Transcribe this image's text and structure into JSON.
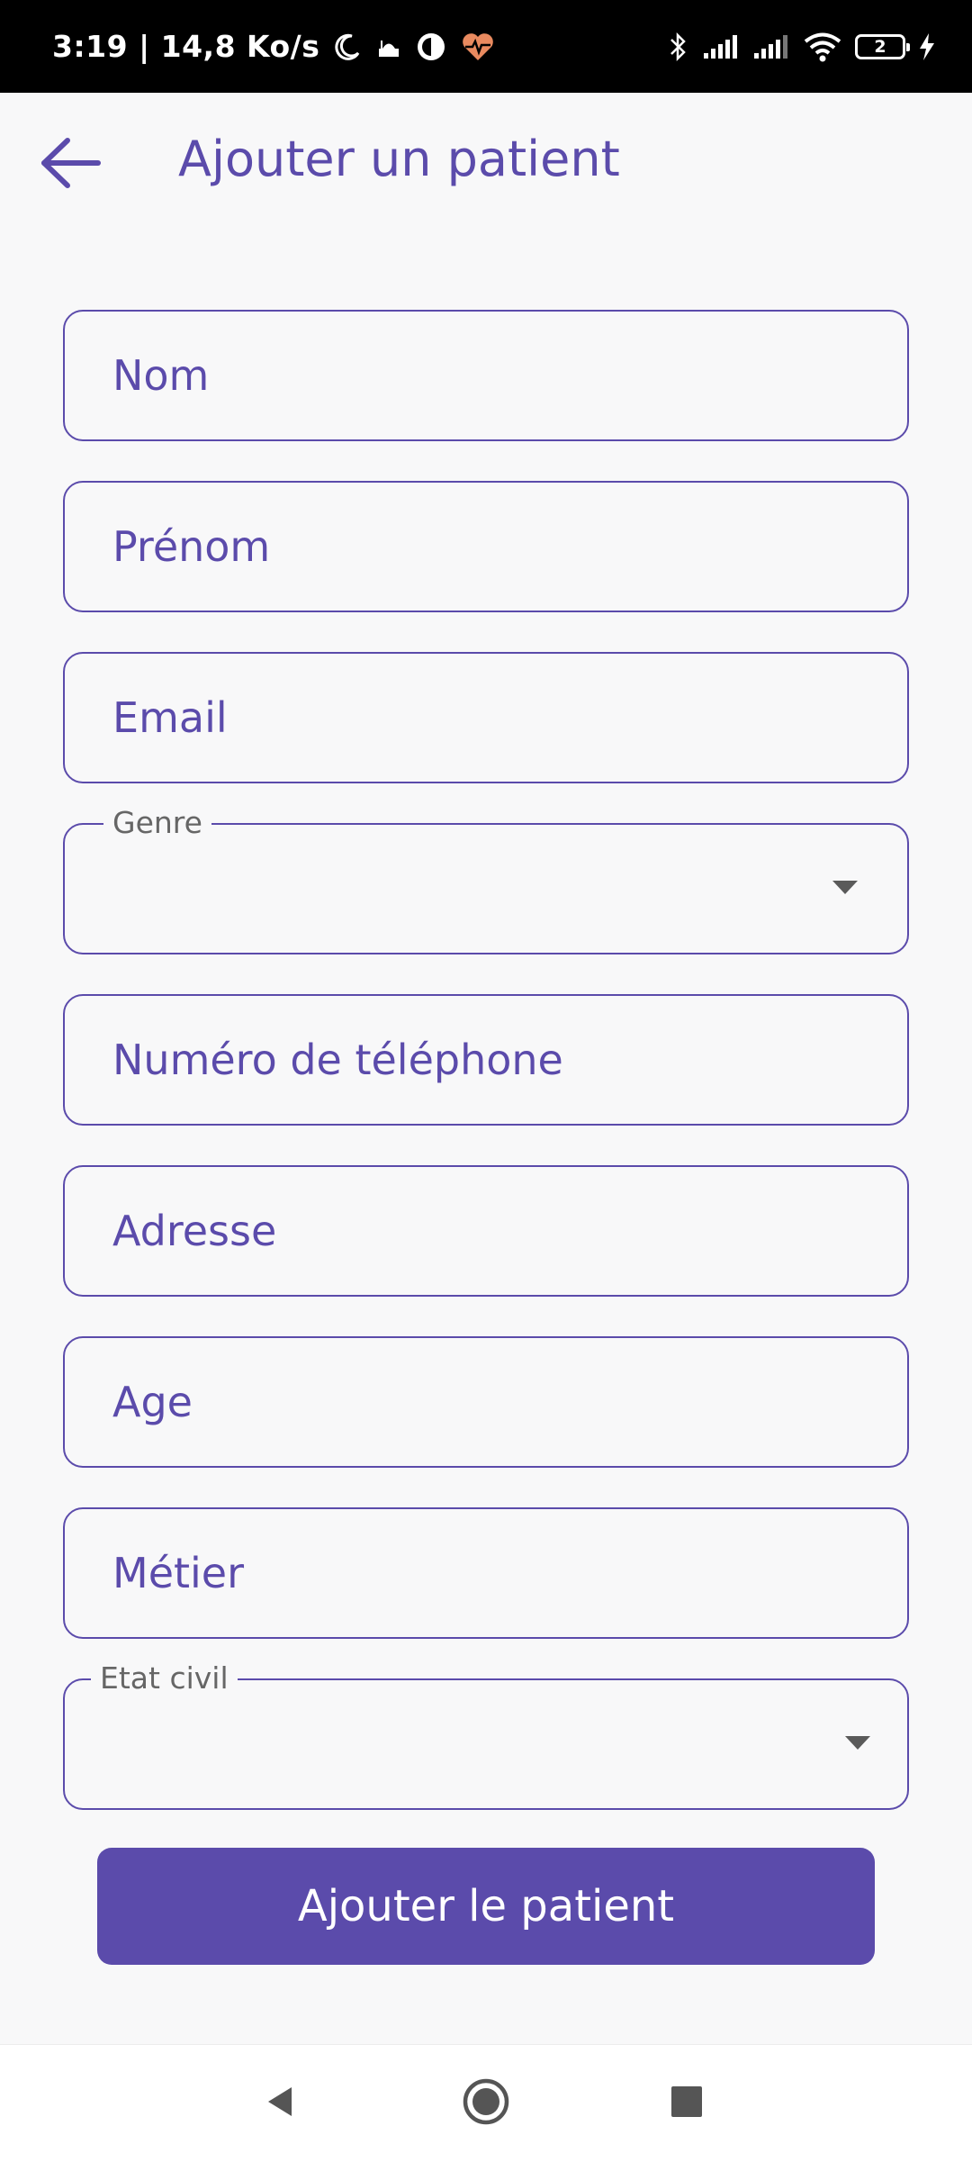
{
  "status_bar": {
    "time": "3:19 | 14,8 Ko/s",
    "battery_level": "2",
    "left_icons": [
      "moon-icon",
      "mosque-icon",
      "app-icon",
      "heart-rate-icon"
    ],
    "right_icons": [
      "bluetooth-icon",
      "signal-icon",
      "signal-icon",
      "wifi-icon",
      "battery-icon",
      "charging-icon"
    ]
  },
  "header": {
    "title": "Ajouter un patient",
    "back_icon": "arrow-left-icon"
  },
  "form": {
    "nom_placeholder": "Nom",
    "prenom_placeholder": "Prénom",
    "email_placeholder": "Email",
    "genre_label": "Genre",
    "telephone_placeholder": "Numéro de téléphone",
    "adresse_placeholder": "Adresse",
    "age_placeholder": "Age",
    "metier_placeholder": "Métier",
    "etat_civil_label": "Etat civil"
  },
  "submit_label": "Ajouter le patient",
  "nav_bar": {
    "icons": [
      "back-triangle-icon",
      "home-circle-icon",
      "recents-square-icon"
    ]
  },
  "colors": {
    "accent": "#5b4bab",
    "background": "#f8f8f9",
    "status_bar": "#000000",
    "heart_icon": "#e98a5f"
  }
}
